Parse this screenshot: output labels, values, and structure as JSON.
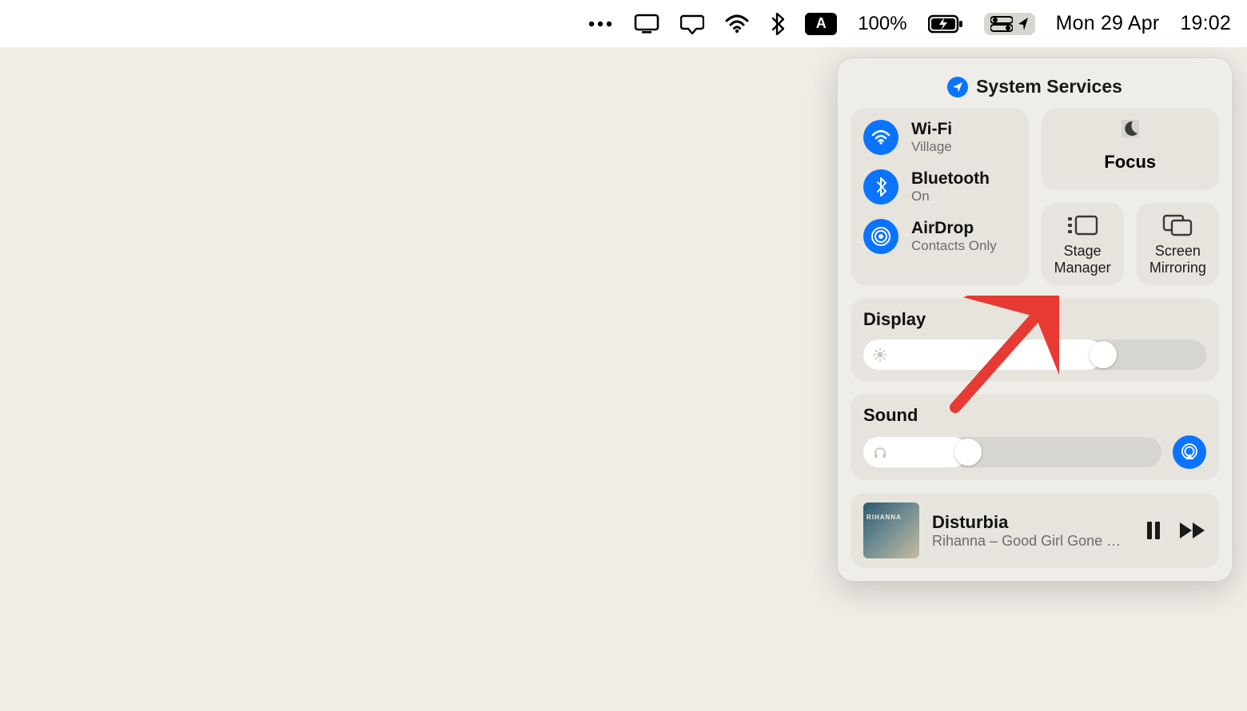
{
  "menubar": {
    "battery_percent": "100%",
    "input_source": "A",
    "date": "Mon 29 Apr",
    "time": "19:02"
  },
  "control_center": {
    "header": "System Services",
    "wifi": {
      "title": "Wi-Fi",
      "subtitle": "Village"
    },
    "bluetooth": {
      "title": "Bluetooth",
      "subtitle": "On"
    },
    "airdrop": {
      "title": "AirDrop",
      "subtitle": "Contacts Only"
    },
    "focus": {
      "title": "Focus"
    },
    "stage_manager": {
      "label": "Stage Manager"
    },
    "screen_mirroring": {
      "label": "Screen Mirroring"
    },
    "display": {
      "title": "Display",
      "value_pct": 70
    },
    "sound": {
      "title": "Sound",
      "value_pct": 35
    },
    "now_playing": {
      "track": "Disturbia",
      "meta": "Rihanna – Good Girl Gone Ba..."
    }
  }
}
